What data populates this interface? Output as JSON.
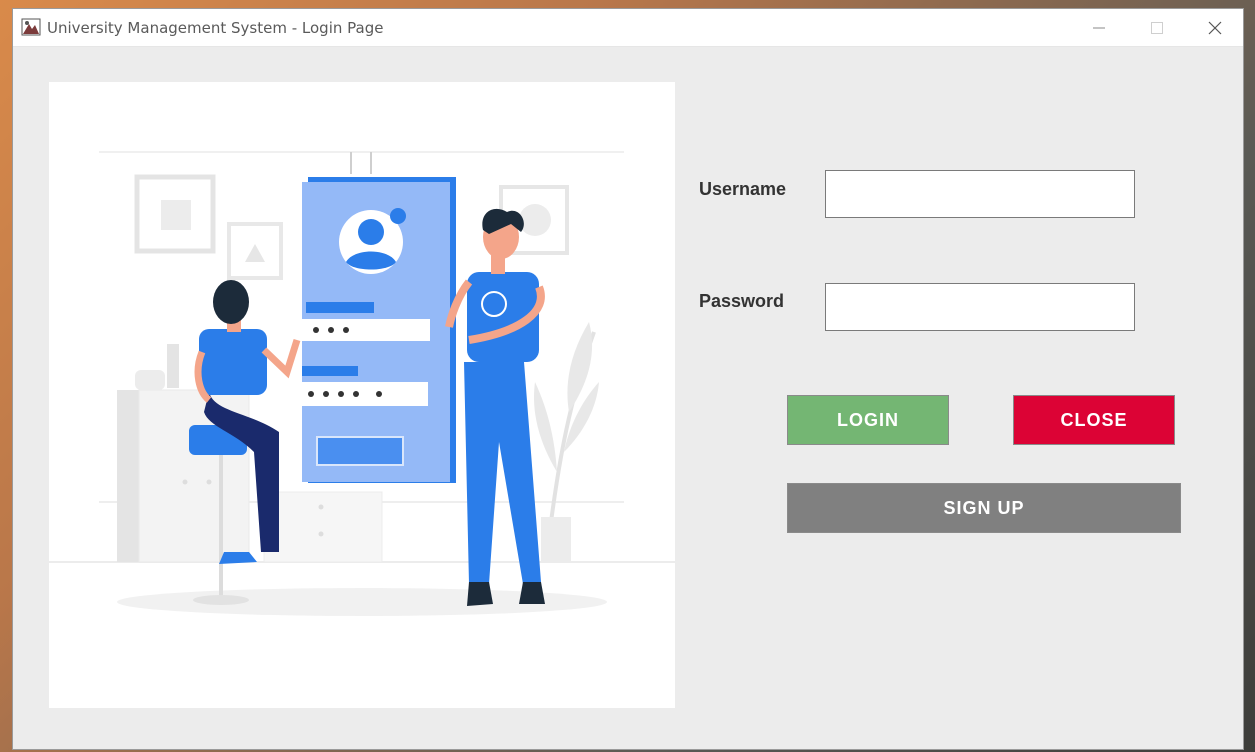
{
  "window": {
    "title": "University Management System - Login Page"
  },
  "form": {
    "username_label": "Username",
    "password_label": "Password",
    "username_value": "",
    "password_value": ""
  },
  "buttons": {
    "login": "LOGIN",
    "close": "CLOSE",
    "signup": "SIGN UP"
  },
  "colors": {
    "login": "#74b673",
    "close": "#dc0335",
    "signup": "#808080",
    "illustration_blue": "#2b7de9"
  }
}
